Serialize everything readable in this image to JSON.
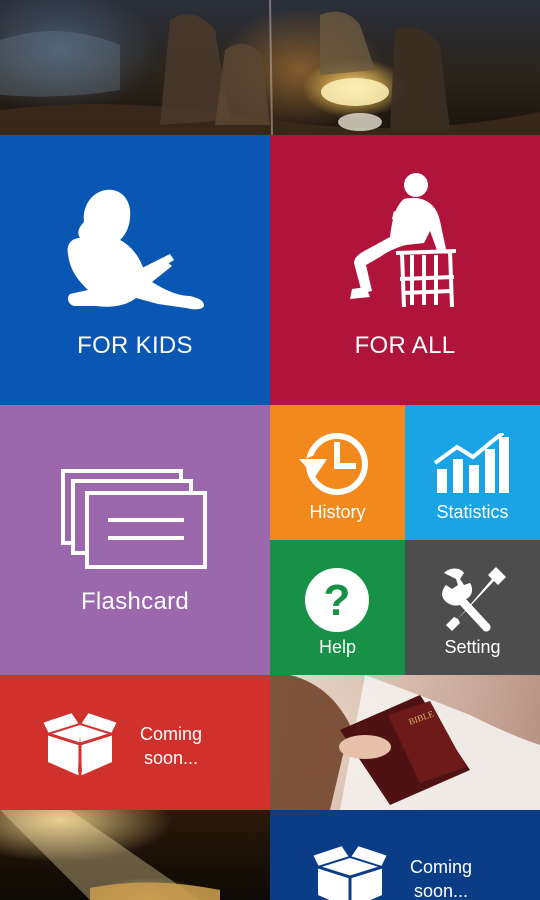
{
  "tiles": {
    "for_kids": {
      "label": "FOR KIDS",
      "color": "#0a56b3"
    },
    "for_all": {
      "label": "FOR ALL",
      "color": "#b0143a"
    },
    "flashcard": {
      "label": "Flashcard",
      "color": "#9b67ad"
    },
    "history": {
      "label": "History",
      "color": "#f3891d"
    },
    "statistics": {
      "label": "Statistics",
      "color": "#1aa4e6"
    },
    "help": {
      "label": "Help",
      "color": "#179147"
    },
    "setting": {
      "label": "Setting",
      "color": "#4d4d4d"
    },
    "coming_soon_1": {
      "label_line1": "Coming",
      "label_line2": "soon...",
      "color": "#d0312d"
    },
    "coming_soon_2": {
      "label_line1": "Coming",
      "label_line2": "soon...",
      "color": "#0b3d86"
    }
  },
  "icons": {
    "for_kids": "child-reading-icon",
    "for_all": "adult-reading-icon",
    "flashcard": "flashcard-stack-icon",
    "history": "clock-history-icon",
    "statistics": "bar-chart-icon",
    "help": "question-mark-icon",
    "setting": "wrench-screwdriver-icon",
    "coming_soon": "open-box-icon"
  }
}
